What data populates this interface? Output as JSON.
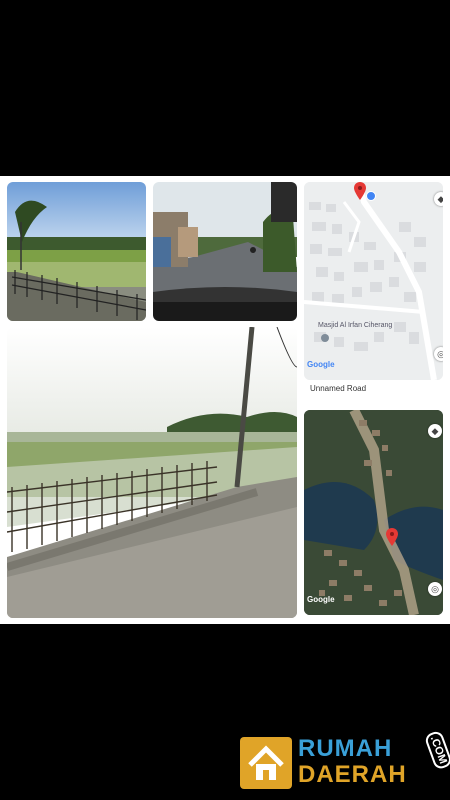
{
  "map_top": {
    "label": "Masjid Al Irfan Ciherang",
    "road": "Unnamed Road",
    "brand": "Google"
  },
  "map_bottom": {
    "brand": "Google"
  },
  "logo": {
    "line1": "RUMAH",
    "line2": "DAERAH",
    "suffix": ".COM"
  },
  "colors": {
    "background": "#000000",
    "canvas": "#ffffff",
    "logo_blue": "#3aa0d8",
    "logo_gold": "#e0a428",
    "map_pin": "#e53935"
  }
}
